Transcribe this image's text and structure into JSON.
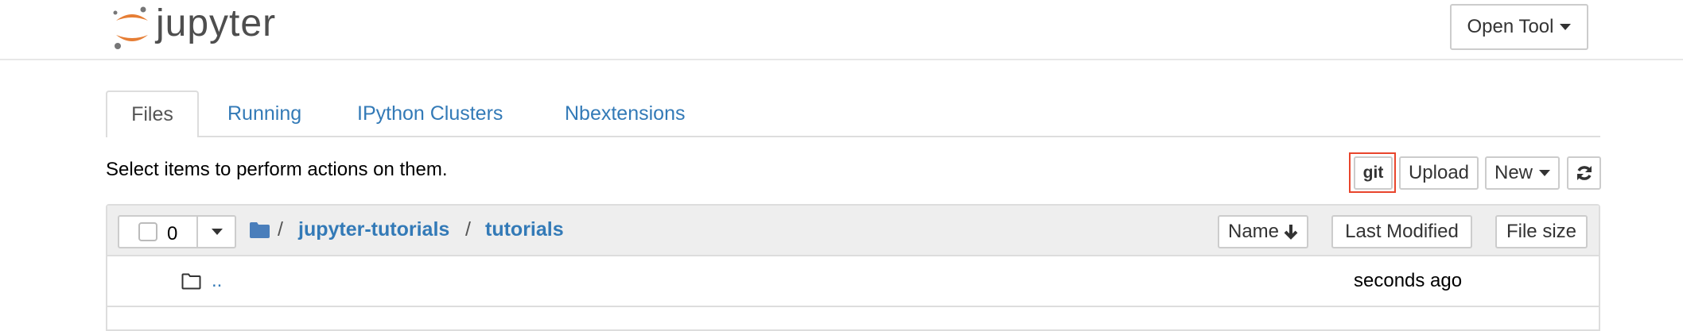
{
  "header": {
    "logo_text": "jupyter",
    "open_tool_label": "Open Tool"
  },
  "tabs": [
    {
      "label": "Files",
      "active": true
    },
    {
      "label": "Running"
    },
    {
      "label": "IPython Clusters"
    },
    {
      "label": "Nbextensions"
    }
  ],
  "toolbar": {
    "hint": "Select items to perform actions on them.",
    "git_label": "git",
    "upload_label": "Upload",
    "new_label": "New"
  },
  "list": {
    "selected_count": "0",
    "breadcrumb": [
      "jupyter-tutorials",
      "tutorials"
    ],
    "separator": "/",
    "columns": {
      "name": "Name",
      "last_modified": "Last Modified",
      "file_size": "File size"
    },
    "rows": [
      {
        "name": "..",
        "modified": "seconds ago"
      }
    ]
  },
  "colors": {
    "link": "#337ab7",
    "highlight": "#e8452c",
    "logo_orange": "#e67e35"
  }
}
